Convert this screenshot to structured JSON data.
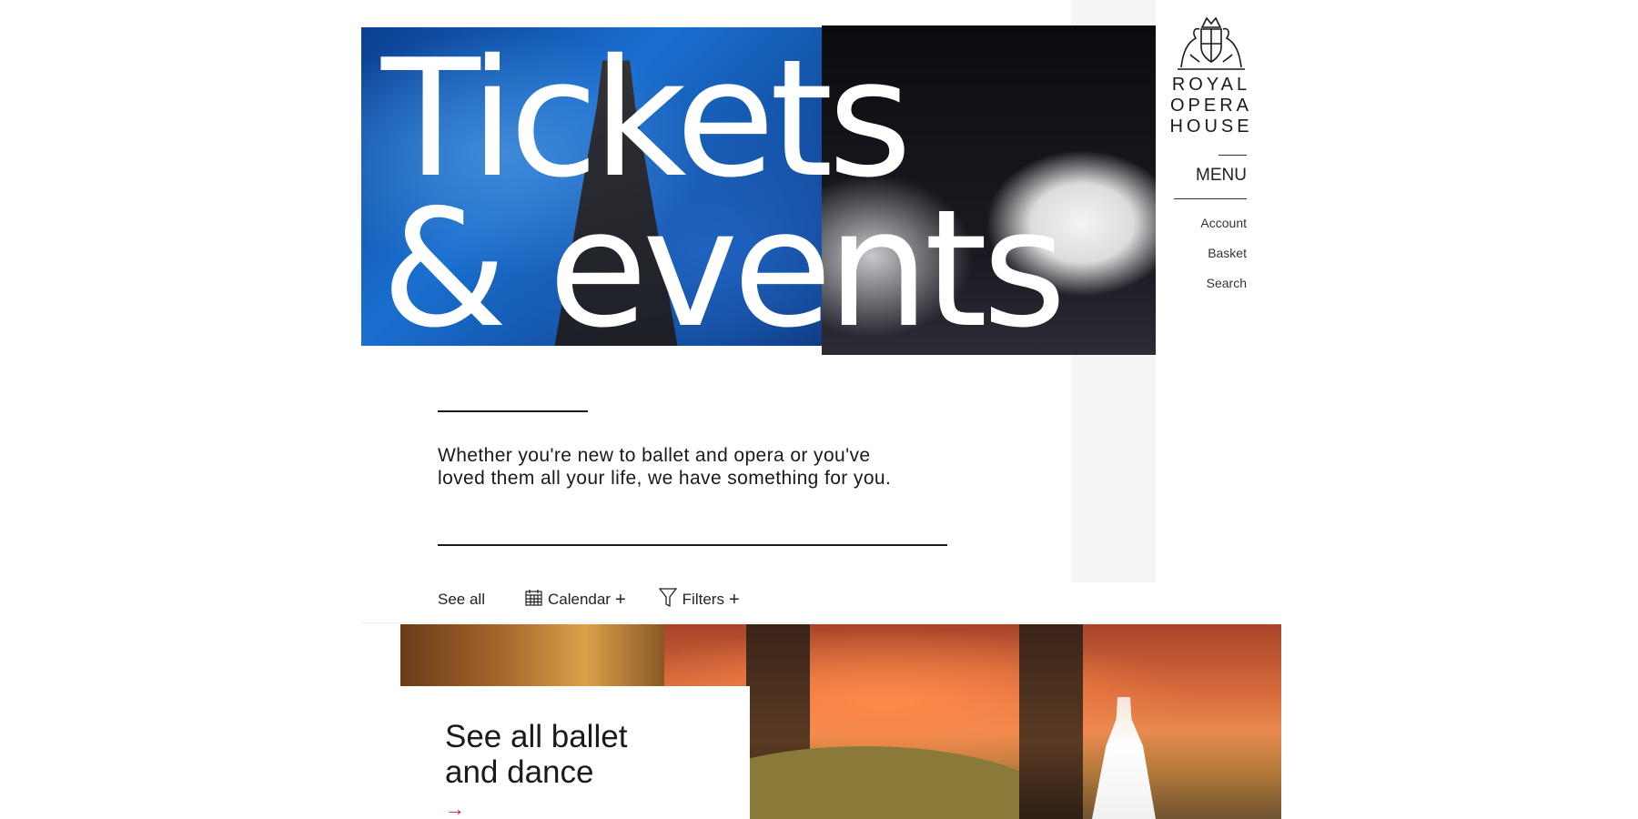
{
  "brand": {
    "logo_lines": [
      "ROYAL",
      "OPERA",
      "HOUSE"
    ]
  },
  "hero": {
    "title_line1": "Tickets",
    "title_line2": "& events"
  },
  "nav": {
    "menu_label": "MENU",
    "account": "Account",
    "basket": "Basket",
    "search": "Search"
  },
  "intro": {
    "text": "Whether you're new to ballet and opera or you've loved them all your life, we have something for you."
  },
  "filters": {
    "see_all": "See all",
    "calendar": "Calendar",
    "filters": "Filters",
    "plus": "+"
  },
  "feature": {
    "title": "See all ballet and dance",
    "arrow": "→"
  },
  "icons": {
    "calendar": "calendar-icon",
    "filter": "filter-icon",
    "crest": "crest-icon",
    "arrow": "arrow-right-icon"
  },
  "colors": {
    "accent_arrow": "#c0264a",
    "panel_grey": "#f5f5f5"
  }
}
